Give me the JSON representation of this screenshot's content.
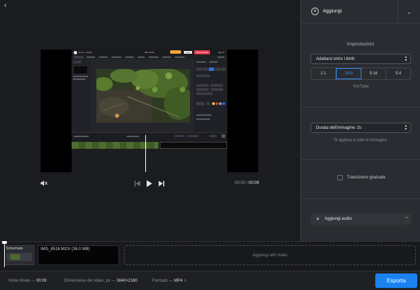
{
  "nav": {
    "back_icon": "‹"
  },
  "panel": {
    "add_label": "Aggiungi",
    "settings_title": "Impostazioni",
    "fit_select": "Adattarsi entro i limiti",
    "ratios": [
      "1:1",
      "16:9",
      "9:16",
      "5:4"
    ],
    "active_ratio": "16:9",
    "ratio_hint": "YouTube",
    "duration_select": "Durata dell'immagine: 2s",
    "duration_hint": "Si applica a tutte le immagini.",
    "transition_label": "Transizione graduale",
    "audio_label": "Aggiungi audio"
  },
  "player": {
    "current_time": "00:00",
    "separator": "/",
    "total_time": "00:09"
  },
  "timeline": {
    "thumb_label": "Schermata",
    "clip_label": "IMG_8516.MOV (38.0 MB)",
    "add_more": "Aggiungi altri video"
  },
  "footer": {
    "final_video_label": "Video finale —",
    "final_video_value": "00:09",
    "size_label": "Dimensione del video, px —",
    "size_value": "3840×2160",
    "format_label": "Formato —",
    "format_value": "MP4",
    "export_label": "Esporta"
  },
  "inner": {
    "app_title": "Home – Studio",
    "file_name": "IMG_8516",
    "share": "Share",
    "export": "Export Video",
    "sign_in": "Sign in"
  },
  "colors": {
    "accent": "#1a82f0",
    "active_ratio": "#2e8cf5",
    "inner_export": "#e63a52",
    "inner_upgrade": "#f2a93b"
  }
}
